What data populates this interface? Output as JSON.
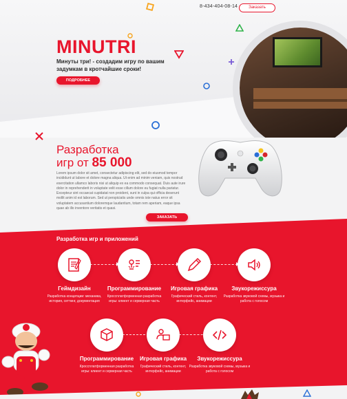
{
  "header": {
    "phone": "8-434-404-08-14",
    "order_label": "Заказать"
  },
  "hero": {
    "brand": "MINUTRI",
    "tagline": "Минуты три! - создадим игру по вашим задумкам в кротчайшие сроки!",
    "more_label": "ПОДРОБНЕЕ"
  },
  "dev": {
    "title_line1": "Разработка",
    "title_line2": "игр от",
    "price": "85 000",
    "lorem": "Lorem ipsum dolor sit amet, consectetur adipiscing elit, sed do eiusmod tempor incididunt ut labore et dolore magna aliqua. Ut enim ad minim veniam, quis nostrud exercitation ullamco laboris nisi ut aliquip ex ea commodo consequat. Duis aute irure dolor in reprehenderit in voluptate velit esse cillum dolore eu fugiat nulla pariatur. Excepteur sint occaecat cupidatat non proident, sunt in culpa qui officia deserunt mollit anim id est laborum. Sed ut perspiciatis unde omnis iste natus error sit voluptatem accusantium doloremque laudantium, totam rem aperiam, eaque ipsa quae ab illo inventore veritatis et quasi.",
    "order_label": "ЗАКАЗАТЬ"
  },
  "services": {
    "title": "Разработка игр и приложений",
    "row1": [
      {
        "name": "Геймдизайн",
        "desc": "Разработка концепции: механика, история, сеттинг, документация",
        "icon": "design-doc-icon"
      },
      {
        "name": "Программирование",
        "desc": "Кроссплатформенная разработка игры: клиент и серверная часть",
        "icon": "bug-code-icon"
      },
      {
        "name": "Игровая графика",
        "desc": "Графический стиль, контент, интерфейс, анимации",
        "icon": "pencil-icon"
      },
      {
        "name": "Звукорежиссура",
        "desc": "Разработка звуковой схемы, музыка и работа с голосом",
        "icon": "speaker-icon"
      }
    ],
    "row2": [
      {
        "name": "Программирование",
        "desc": "Кроссплатформенная разработка игры: клиент и серверная часть",
        "icon": "cube-icon"
      },
      {
        "name": "Игровая графика",
        "desc": "Графический стиль, контент, интерфейс, анимации",
        "icon": "developer-icon"
      },
      {
        "name": "Звукорежиссура",
        "desc": "Разработка звуковой схемы, музыка и работа с голосом",
        "icon": "code-icon"
      }
    ]
  },
  "colors": {
    "accent": "#e8152c",
    "background": "#f3f3f4",
    "text": "#2b2b2b"
  }
}
